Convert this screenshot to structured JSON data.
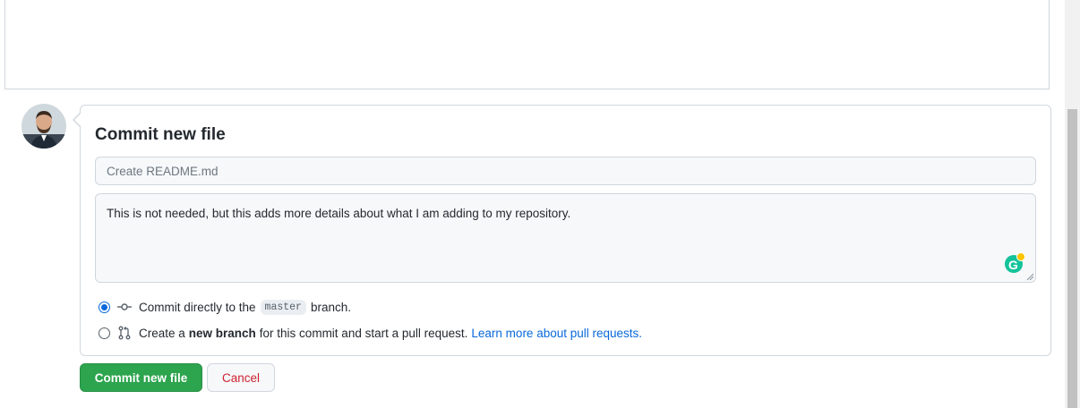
{
  "commit": {
    "title": "Commit new file",
    "summary_placeholder": "Create README.md",
    "summary_value": "",
    "description": "This is not needed, but this adds more details about what I am adding to my repository."
  },
  "options": {
    "direct": {
      "prefix": "Commit directly to the",
      "branch": "master",
      "suffix": "branch."
    },
    "new_branch": {
      "prefix": "Create a",
      "bold": "new branch",
      "suffix": "for this commit and start a pull request.",
      "link": "Learn more about pull requests."
    }
  },
  "buttons": {
    "commit_label": "Commit new file",
    "cancel_label": "Cancel"
  },
  "colors": {
    "primary": "#2da44e",
    "link": "#0969da",
    "cancel": "#cf222e"
  }
}
